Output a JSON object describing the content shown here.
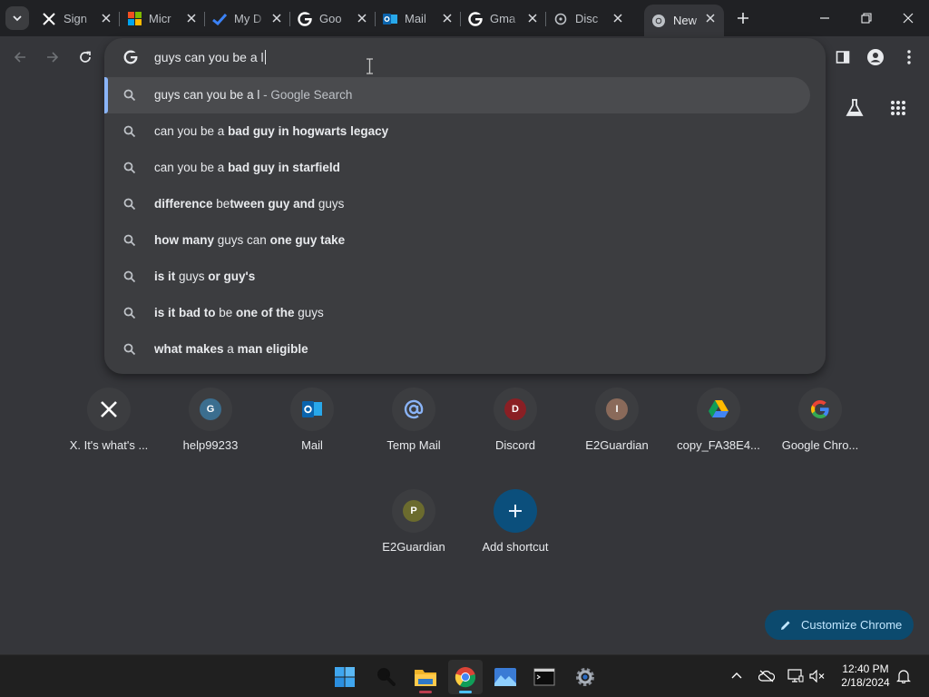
{
  "tabs": [
    {
      "title": "Sign",
      "icon": "x-logo-icon"
    },
    {
      "title": "Micr",
      "icon": "microsoft-logo-icon"
    },
    {
      "title": "My D",
      "icon": "checkmark-icon"
    },
    {
      "title": "Goo",
      "icon": "google-logo-icon"
    },
    {
      "title": "Mail",
      "icon": "outlook-icon"
    },
    {
      "title": "Gma",
      "icon": "google-logo-icon"
    },
    {
      "title": "Disc",
      "icon": "discord-icon"
    },
    {
      "title": "New",
      "icon": "chrome-icon"
    }
  ],
  "omnibox": {
    "query": "guys can you be a l",
    "suggestions": [
      {
        "parts": [
          {
            "t": "guys can you be a l",
            "b": false
          },
          {
            "t": " - Google Search",
            "b": false,
            "dim": true
          }
        ]
      },
      {
        "parts": [
          {
            "t": "can you be a ",
            "b": false
          },
          {
            "t": "bad guy in hogwarts legacy",
            "b": true
          }
        ]
      },
      {
        "parts": [
          {
            "t": "can you be a ",
            "b": false
          },
          {
            "t": "bad guy in starfield",
            "b": true
          }
        ]
      },
      {
        "parts": [
          {
            "t": "difference ",
            "b": true
          },
          {
            "t": "be",
            "b": false
          },
          {
            "t": "tween guy",
            "b": true
          },
          {
            "t": " ",
            "b": false
          },
          {
            "t": "and",
            "b": true
          },
          {
            "t": " guys",
            "b": false
          }
        ]
      },
      {
        "parts": [
          {
            "t": "how many",
            "b": true
          },
          {
            "t": " guys ",
            "b": false
          },
          {
            "t": "can",
            "b": false
          },
          {
            "t": " ",
            "b": false
          },
          {
            "t": "one guy take",
            "b": true
          }
        ]
      },
      {
        "parts": [
          {
            "t": "is it",
            "b": true
          },
          {
            "t": " guys ",
            "b": false
          },
          {
            "t": "or guy's",
            "b": true
          }
        ]
      },
      {
        "parts": [
          {
            "t": "is it bad to",
            "b": true
          },
          {
            "t": " be ",
            "b": false
          },
          {
            "t": "one of the",
            "b": true
          },
          {
            "t": " guys",
            "b": false
          }
        ]
      },
      {
        "parts": [
          {
            "t": "what makes",
            "b": true
          },
          {
            "t": " a ",
            "b": false
          },
          {
            "t": "man eligible",
            "b": true
          }
        ]
      }
    ]
  },
  "shortcuts": [
    {
      "label": "X. It's what's ...",
      "letter": "",
      "icon": "x-logo-icon"
    },
    {
      "label": "help99233",
      "letter": "G",
      "color": "#3b6e8f"
    },
    {
      "label": "Mail",
      "letter": "",
      "icon": "outlook-icon"
    },
    {
      "label": "Temp Mail",
      "letter": "",
      "icon": "at-sign-icon"
    },
    {
      "label": "Discord",
      "letter": "D",
      "color": "#8a1f24"
    },
    {
      "label": "E2Guardian",
      "letter": "I",
      "color": "#8a6a5a"
    },
    {
      "label": "copy_FA38E4...",
      "letter": "",
      "icon": "google-drive-icon"
    },
    {
      "label": "Google Chro...",
      "letter": "",
      "icon": "google-logo-icon"
    },
    {
      "label": "E2Guardian",
      "letter": "P",
      "color": "#6b6b2e"
    },
    {
      "label": "Add shortcut",
      "letter": "",
      "icon": "plus-icon"
    }
  ],
  "customize": {
    "label": "Customize Chrome"
  },
  "taskbar": {
    "time": "12:40 PM",
    "date": "2/18/2024"
  },
  "colors": {
    "accent": "#8ab4f8",
    "customize_bg": "#0c4a6e",
    "taskbar_active": "#4cc2ff"
  }
}
